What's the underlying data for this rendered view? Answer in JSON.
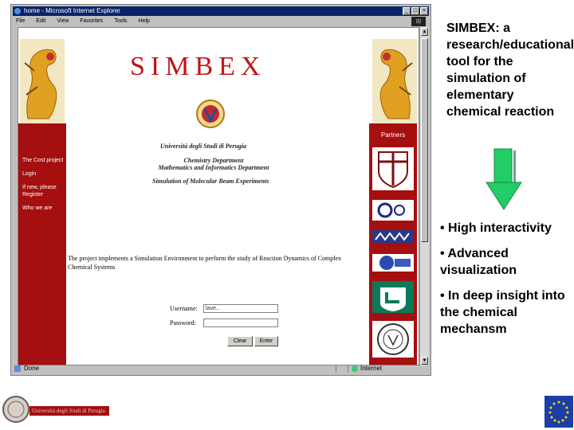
{
  "browser": {
    "title": "home - Microsoft Internet Explorer",
    "menu": [
      "File",
      "Edit",
      "View",
      "Favorites",
      "Tools",
      "Help"
    ],
    "status_left": "Done",
    "status_zone": "Internet"
  },
  "page": {
    "logo": "SIMBEX",
    "university": "Università degli Studi di Perugia",
    "department_lines": [
      "Chemistry Department",
      "Mathematics and Informatics Department"
    ],
    "simulation": "Simulation of Molecular Beam Experiments",
    "nav": [
      "The Cost project",
      "Login",
      "If new, please Register",
      "Who we are"
    ],
    "partners_label": "Partners",
    "description": "The project implements a Simulation Environment to perform the study of Reaction Dynamics of Complex Chemical Systems",
    "form": {
      "username_label": "Username:",
      "username_value": "lave...",
      "password_label": "Password:",
      "clear_button": "Clear",
      "enter_button": "Enter"
    }
  },
  "slide": {
    "title": "SIMBEX: a research/educational tool for the simulation of elementary chemical reaction",
    "bullets": [
      "• High interactivity",
      "• Advanced visualization",
      "• In deep insight into the chemical mechansm"
    ],
    "footer_label": "Università degli Studi di Perugia"
  },
  "colors": {
    "brand_red": "#a50f0f",
    "logo_red": "#c01616",
    "titlebar": "#0a246a",
    "arrow_green": "#22cc66"
  }
}
